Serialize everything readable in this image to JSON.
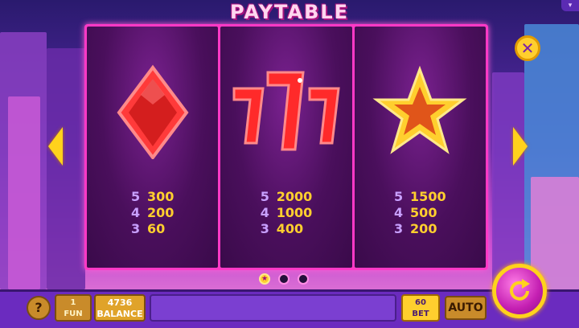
{
  "title": "PAYTABLE",
  "colors": {
    "gold": "#ffcf2e",
    "pink": "#ff39c6",
    "purple": "#6b2bbf"
  },
  "icons": {
    "top_right": "menu-icon",
    "close": "close-icon",
    "prev": "arrow-left-icon",
    "next": "arrow-right-icon",
    "spin": "spin-icon",
    "help": "help-icon"
  },
  "columns": [
    {
      "symbol": "red-diamond-icon",
      "pays": [
        {
          "count": "5",
          "value": "300"
        },
        {
          "count": "4",
          "value": "200"
        },
        {
          "count": "3",
          "value": "60"
        }
      ]
    },
    {
      "symbol": "triple-seven-icon",
      "pays": [
        {
          "count": "5",
          "value": "2000"
        },
        {
          "count": "4",
          "value": "1000"
        },
        {
          "count": "3",
          "value": "400"
        }
      ]
    },
    {
      "symbol": "gold-star-icon",
      "pays": [
        {
          "count": "5",
          "value": "1500"
        },
        {
          "count": "4",
          "value": "500"
        },
        {
          "count": "3",
          "value": "200"
        }
      ]
    }
  ],
  "pagination": {
    "pages": 3,
    "active": 1
  },
  "bottom": {
    "help_label": "?",
    "fun_value": "1",
    "fun_label": "FUN",
    "balance_value": "4736",
    "balance_label": "BALANCE",
    "bet_value": "60",
    "bet_label": "BET",
    "auto_label": "AUTO"
  }
}
